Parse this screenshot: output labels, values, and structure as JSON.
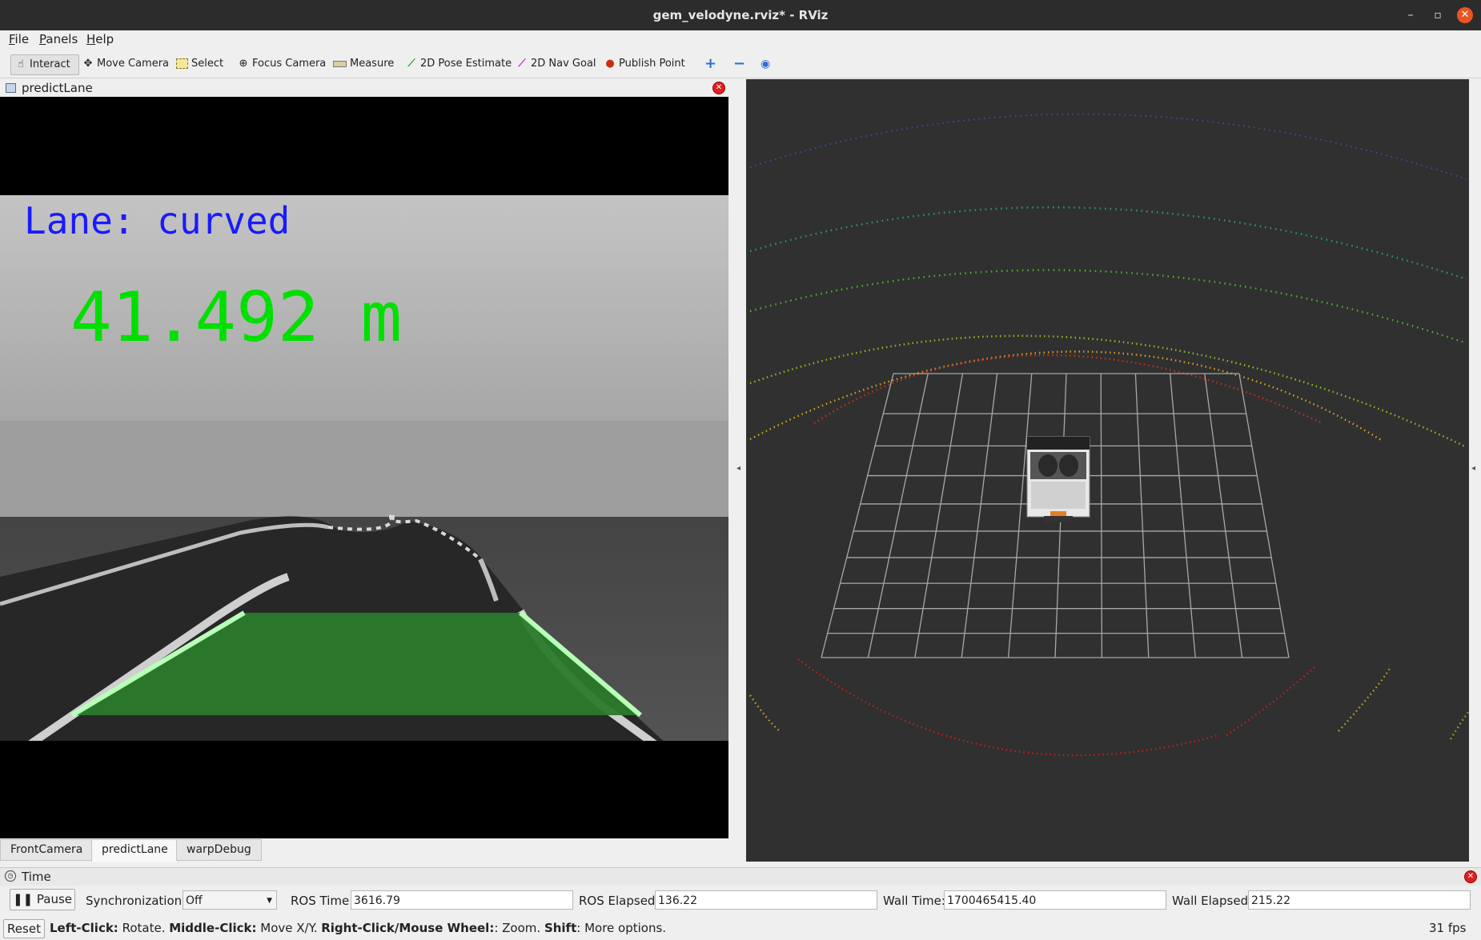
{
  "window": {
    "title": "gem_velodyne.rviz* - RViz",
    "minimize": "–",
    "maximize": "▫",
    "close": "✕"
  },
  "menu": {
    "items": [
      {
        "pre": "",
        "key": "F",
        "post": "ile"
      },
      {
        "pre": "",
        "key": "P",
        "post": "anels"
      },
      {
        "pre": "",
        "key": "H",
        "post": "elp"
      }
    ]
  },
  "toolbar": {
    "interact": "Interact",
    "move_camera": "Move Camera",
    "select": "Select",
    "focus_camera": "Focus Camera",
    "measure": "Measure",
    "pose_estimate": "2D Pose Estimate",
    "nav_goal": "2D Nav Goal",
    "publish_point": "Publish Point"
  },
  "image_panel": {
    "title": "predictLane",
    "lane_text": "Lane: curved",
    "distance_text": "41.492 m",
    "tabs": [
      "FrontCamera",
      "predictLane",
      "warpDebug"
    ],
    "active_tab": 1
  },
  "time_panel": {
    "title": "Time",
    "pause_label": "Pause",
    "sync_label": "Synchronization:",
    "sync_value": "Off",
    "ros_time_label": "ROS Time:",
    "ros_time": "3616.79",
    "ros_elapsed_label": "ROS Elapsed:",
    "ros_elapsed": "136.22",
    "wall_time_label": "Wall Time:",
    "wall_time": "1700465415.40",
    "wall_elapsed_label": "Wall Elapsed:",
    "wall_elapsed": "215.22"
  },
  "status": {
    "reset_label": "Reset",
    "hint_1b": "Left-Click:",
    "hint_1": " Rotate. ",
    "hint_2b": "Middle-Click:",
    "hint_2": " Move X/Y. ",
    "hint_3b": "Right-Click/Mouse Wheel:",
    "hint_3": ": Zoom. ",
    "hint_4b": "Shift",
    "hint_4": ": More options.",
    "fps": "31 fps"
  },
  "colors": {
    "lane_text": "#1a1aff",
    "distance_text": "#00e000",
    "lane_fill": "#2e7d2e",
    "view_bg": "#303030"
  }
}
